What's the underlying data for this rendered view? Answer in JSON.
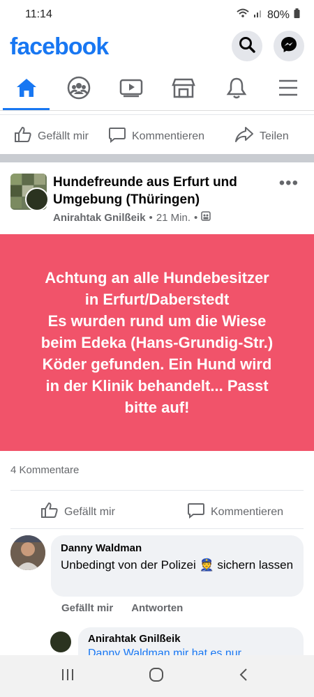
{
  "status": {
    "time": "11:14",
    "battery": "80%"
  },
  "brand": {
    "logo": "facebook",
    "color": "#1877f2"
  },
  "header_icons": [
    "search-icon",
    "messenger-icon"
  ],
  "nav": [
    "home-icon",
    "groups-icon",
    "video-icon",
    "marketplace-icon",
    "notifications-icon",
    "menu-icon"
  ],
  "top_actions": {
    "like": "Gefällt mir",
    "comment": "Kommentieren",
    "share": "Teilen"
  },
  "post": {
    "group_name": "Hundefreunde aus Erfurt und Umgebung (Thüringen)",
    "author": "Anirahtak Gnilßeik",
    "time": "21 Min.",
    "banner_color": "#f1536a",
    "banner_lines": [
      "Achtung an alle Hundebesitzer",
      "in Erfurt/Daberstedt",
      "Es wurden rund um die Wiese",
      "beim Edeka (Hans-Grundig-Str.)",
      "Köder gefunden. Ein Hund wird",
      "in der Klinik behandelt... Passt",
      "bitte auf!"
    ],
    "comment_count": "4 Kommentare",
    "like_label": "Gefällt mir",
    "comment_label": "Kommentieren"
  },
  "comment": {
    "name": "Danny Waldman",
    "text_before": "Unbedingt von der Polizei",
    "emoji": "👮",
    "text_after": "sichern lassen",
    "like": "Gefällt mir",
    "reply": "Antworten"
  },
  "reply": {
    "name": "Anirahtak Gnilßeik",
    "text": "Danny Waldman mir hat es nur"
  },
  "bottom_nav": [
    "recent-apps-icon",
    "home-circle-icon",
    "back-icon"
  ]
}
